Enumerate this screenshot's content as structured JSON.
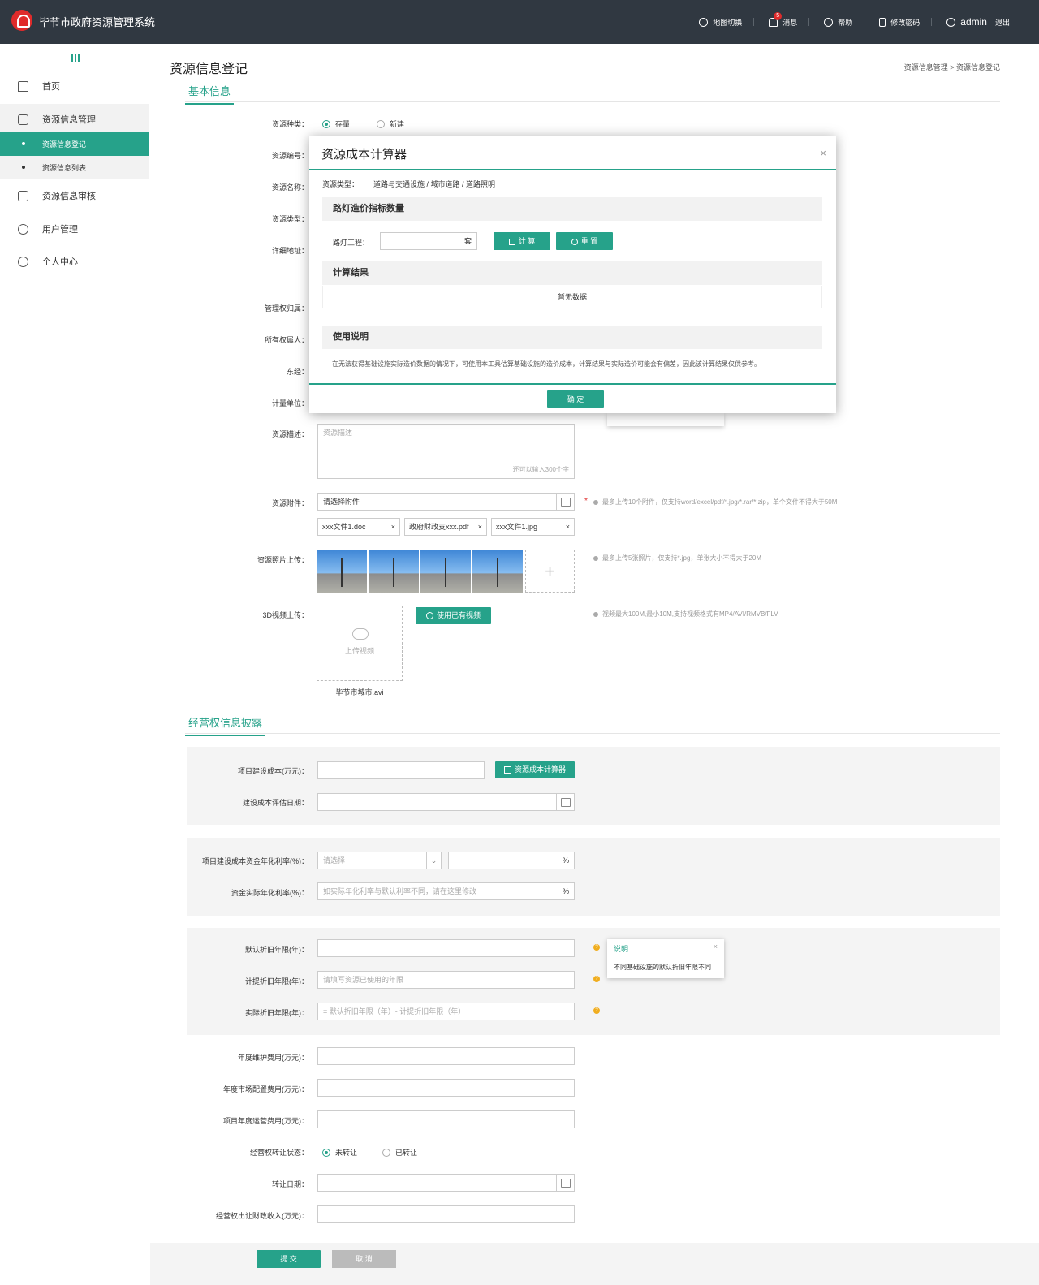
{
  "header": {
    "app_title": "毕节市政府资源管理系统",
    "nav": {
      "map_switch": "地图切换",
      "messages": "消息",
      "message_count": "5",
      "help": "帮助",
      "change_password": "修改密码",
      "user": "admin",
      "logout": "退出"
    }
  },
  "sidebar": {
    "home": "首页",
    "resource_mgmt": "资源信息管理",
    "resource_register": "资源信息登记",
    "resource_list": "资源信息列表",
    "resource_review": "资源信息审核",
    "user_mgmt": "用户管理",
    "personal_center": "个人中心"
  },
  "page": {
    "title": "资源信息登记",
    "breadcrumb": "资源信息管理 > 资源信息登记"
  },
  "basic": {
    "section_title": "基本信息",
    "labels": {
      "resource_kind": "资源种类：",
      "resource_code": "资源编号：",
      "resource_name": "资源名称：",
      "resource_type": "资源类型：",
      "address": "详细地址：",
      "mgmt_right": "管理权归属：",
      "owner": "所有权属人：",
      "longitude": "东经：",
      "unit": "计量单位：",
      "description": "资源描述：",
      "attachment": "资源附件：",
      "photo": "资源照片上传：",
      "video": "3D视频上传："
    },
    "kind_options": [
      "存量",
      "新建"
    ],
    "desc_placeholder": "资源描述",
    "desc_counter": "还可以输入300个字",
    "attachment_placeholder": "请选择附件",
    "attachment_hint": "最多上传10个附件，仅支持word/excel/pdf/*.jpg/*.rar/*.zip，单个文件不得大于50M",
    "files": [
      "xxx文件1.doc",
      "政府财政支xxx.pdf",
      "xxx文件1.jpg"
    ],
    "file_remove": "×",
    "photo_hint": "最多上传5张照片，仅支持*.jpg，单张大小不得大于20M",
    "photo_add": "+",
    "use_video_btn": "使用已有视频",
    "video_upload": "上传视频",
    "video_hint": "视频最大100M,最小10M,支持视频格式有MP4/AVI/RMVB/FLV",
    "video_file": "毕节市城市.avi"
  },
  "operating": {
    "section_title": "经营权信息披露",
    "labels": {
      "build_cost": "项目建设成本(万元)：",
      "cost_eval_date": "建设成本评估日期：",
      "annual_rate": "项目建设成本资金年化利率(%)：",
      "actual_rate": "资金实际年化利率(%)：",
      "default_dep": "默认折旧年限(年)：",
      "accrued_dep": "计提折旧年限(年)：",
      "actual_dep": "实际折旧年限(年)：",
      "maintenance": "年度维护费用(万元)：",
      "market_config": "年度市场配置费用(万元)：",
      "operation": "项目年度运营费用(万元)：",
      "transfer_status": "经营权转让状态：",
      "transfer_date": "转让日期：",
      "fiscal_income": "经营权出让财政收入(万元)："
    },
    "calculator_btn": "资源成本计算器",
    "select_placeholder": "请选择",
    "percent": "%",
    "actual_rate_placeholder": "如实际年化利率与默认利率不同，请在这里修改",
    "accrued_placeholder": "请填写资源已使用的年限",
    "actual_dep_placeholder": "= 默认折旧年限（年）- 计提折旧年限（年）",
    "transfer_options": [
      "未转让",
      "已转让"
    ],
    "popup": {
      "title": "说明",
      "close": "×",
      "body": "不同基础设施的默认折旧年限不同"
    }
  },
  "actions": {
    "submit": "提 交",
    "cancel": "取 消"
  },
  "modal": {
    "title": "资源成本计算器",
    "close": "×",
    "type_label": "资源类型：",
    "type_value": "道路与交通设施 / 城市道路 / 道路照明",
    "band1": "路灯造价指标数量",
    "streetlight_label": "路灯工程：",
    "streetlight_unit": "套",
    "calc_btn": "计 算",
    "reset_btn": "重 置",
    "band2": "计算结果",
    "no_data": "暂无数据",
    "band3": "使用说明",
    "usage_text": "在无法获得基础设施实际造价数据的情况下，可使用本工具估算基础设施的造价成本，计算结果与实际造价可能会有偏差，因此该计算结果仅供参考。",
    "ok_btn": "确 定"
  },
  "colors": {
    "accent": "#26a28a",
    "header_bg": "#303841",
    "logo_red": "#e02b2b",
    "warning": "#f0ad1e"
  }
}
